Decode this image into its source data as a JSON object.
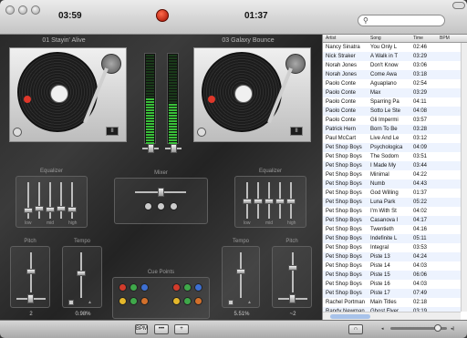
{
  "header": {
    "elapsed": "03:59",
    "remaining": "01:37",
    "search_placeholder": ""
  },
  "deck_left": {
    "title": "01 Stayin' Alive",
    "pitch_value": "2",
    "tempo_value": "0.98%"
  },
  "deck_right": {
    "title": "03 Galaxy Bounce",
    "pitch_value": "~2",
    "tempo_value": "5.51%"
  },
  "pause_label": "II",
  "panels": {
    "equalizer": "Equalizer",
    "mixer": "Mixer",
    "cue_points": "Cue Points",
    "tempo": "Tempo",
    "pitch": "Pitch",
    "low": "low",
    "mid": "mid",
    "high": "high"
  },
  "playlist": {
    "columns": [
      "Artist",
      "Song",
      "Time",
      "BPM"
    ],
    "rows": [
      [
        "Nancy Sinatra",
        "You Only L",
        "02:46"
      ],
      [
        "Nick Straker",
        "A Walk in T",
        "03:29"
      ],
      [
        "Norah Jones",
        "Don't Know",
        "03:06"
      ],
      [
        "Norah Jones",
        "Come Awa",
        "03:18"
      ],
      [
        "Paolo Conte",
        "Aguaplano",
        "02:54"
      ],
      [
        "Paolo Conte",
        "Max",
        "03:29"
      ],
      [
        "Paolo Conte",
        "Sparring Pa",
        "04:11"
      ],
      [
        "Paolo Conte",
        "Sotto Le Ste",
        "04:08"
      ],
      [
        "Paolo Conte",
        "Gli Impermi",
        "03:57"
      ],
      [
        "Patrick Hern",
        "Born To Be",
        "03:28"
      ],
      [
        "Paul McCart",
        "Live And Le",
        "03:12"
      ],
      [
        "Pet Shop Boys",
        "Psychologica",
        "04:09"
      ],
      [
        "Pet Shop Boys",
        "The Sodom",
        "03:51"
      ],
      [
        "Pet Shop Boys",
        "I Made My",
        "03:44"
      ],
      [
        "Pet Shop Boys",
        "Minimal",
        "04:22"
      ],
      [
        "Pet Shop Boys",
        "Numb",
        "04:43"
      ],
      [
        "Pet Shop Boys",
        "God Willing",
        "01:37"
      ],
      [
        "Pet Shop Boys",
        "Luna Park",
        "05:22"
      ],
      [
        "Pet Shop Boys",
        "I'm With St",
        "04:02"
      ],
      [
        "Pet Shop Boys",
        "Casanova I",
        "04:17"
      ],
      [
        "Pet Shop Boys",
        "Twentieth",
        "04:16"
      ],
      [
        "Pet Shop Boys",
        "Indefinite L",
        "05:11"
      ],
      [
        "Pet Shop Boys",
        "Integral",
        "03:53"
      ],
      [
        "Pet Shop Boys",
        "Piste 13",
        "04:24"
      ],
      [
        "Pet Shop Boys",
        "Piste 14",
        "04:03"
      ],
      [
        "Pet Shop Boys",
        "Piste 15",
        "06:06"
      ],
      [
        "Pet Shop Boys",
        "Piste 16",
        "04:03"
      ],
      [
        "Pet Shop Boys",
        "Piste 17",
        "07:49"
      ],
      [
        "Rachel Portman",
        "Main Titles",
        "02:18"
      ],
      [
        "Randy Newman",
        "Ghost Flyer",
        "03:19"
      ],
      [
        "Randy Newman",
        "Carpet Ride",
        "03:02"
      ]
    ]
  },
  "bottom": {
    "bpm_label": "BPM",
    "dots_label": "•••",
    "mid_label": "+"
  },
  "colors": {
    "accent": "#39c039",
    "record": "#c21a00",
    "selection": "#a8c3ea"
  }
}
